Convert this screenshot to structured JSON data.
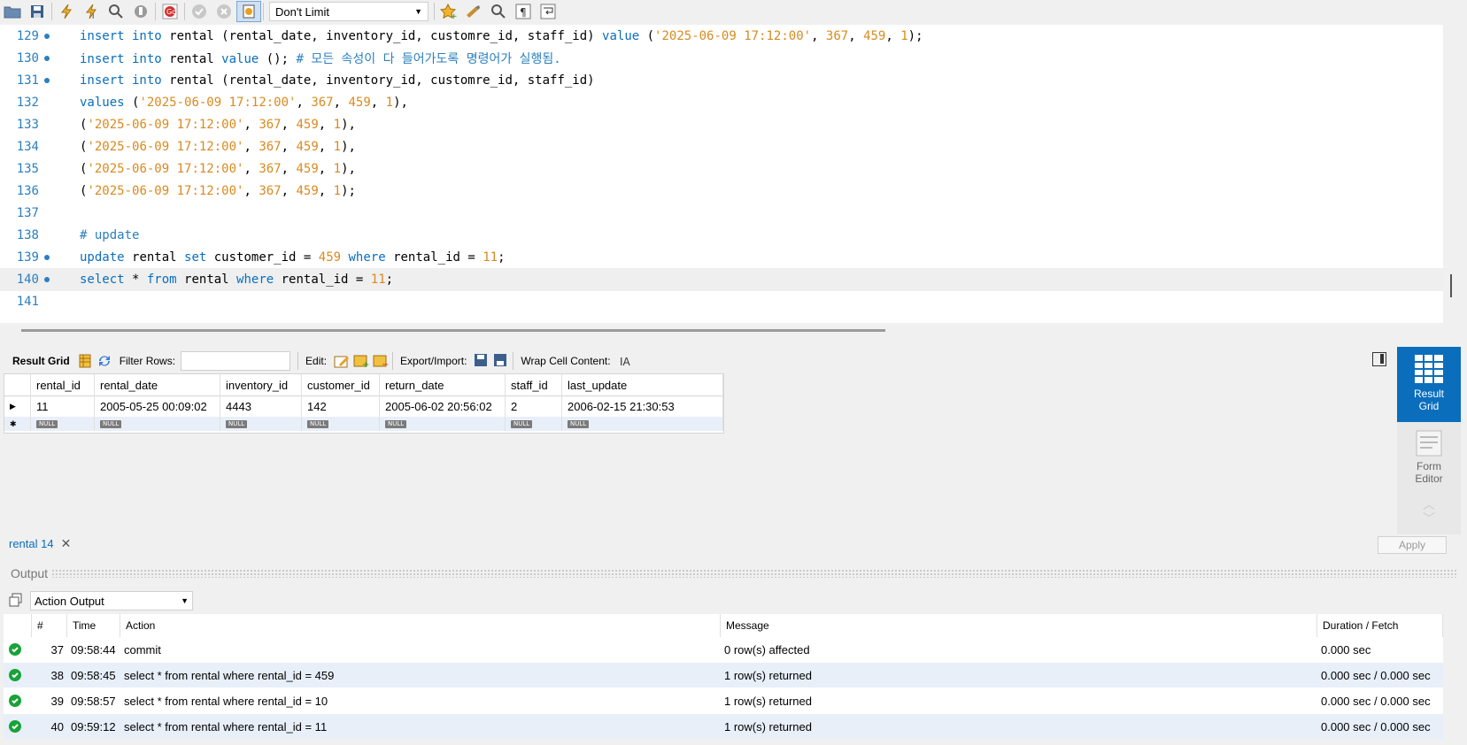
{
  "toolbar": {
    "limit": "Don't Limit",
    "icons": [
      "open-folder-icon",
      "save-icon",
      "execute-icon",
      "execute-current-icon",
      "explain-icon",
      "stop-icon",
      "toggle-error-stop-icon",
      "commit-icon",
      "rollback-icon",
      "autocommit-icon",
      "bookmark-icon",
      "beautify-icon",
      "find-icon",
      "invisible-chars-icon",
      "wrap-lines-icon"
    ]
  },
  "editor": {
    "lines": [
      {
        "n": "129",
        "dot": true,
        "tokens": [
          [
            "kw",
            "insert into "
          ],
          [
            "",
            "rental (rental_date, inventory_id, customre_id, staff_id) "
          ],
          [
            "kw",
            "value "
          ],
          [
            "",
            "("
          ],
          [
            "str",
            "'2025-06-09 17:12:00'"
          ],
          [
            "",
            ", "
          ],
          [
            "num",
            "367"
          ],
          [
            "",
            ", "
          ],
          [
            "num",
            "459"
          ],
          [
            "",
            ", "
          ],
          [
            "num",
            "1"
          ],
          [
            "",
            ");"
          ]
        ]
      },
      {
        "n": "130",
        "dot": true,
        "tokens": [
          [
            "kw",
            "insert into "
          ],
          [
            "",
            "rental "
          ],
          [
            "kw",
            "value "
          ],
          [
            "",
            "(); "
          ],
          [
            "cm",
            "# 모든 속성이 다 들어가도록 명령어가 실행됨."
          ]
        ]
      },
      {
        "n": "131",
        "dot": true,
        "tokens": [
          [
            "kw",
            "insert into "
          ],
          [
            "",
            "rental (rental_date, inventory_id, customre_id, staff_id)"
          ]
        ]
      },
      {
        "n": "132",
        "dot": false,
        "tokens": [
          [
            "kw",
            "values "
          ],
          [
            "",
            "("
          ],
          [
            "str",
            "'2025-06-09 17:12:00'"
          ],
          [
            "",
            ", "
          ],
          [
            "num",
            "367"
          ],
          [
            "",
            ", "
          ],
          [
            "num",
            "459"
          ],
          [
            "",
            ", "
          ],
          [
            "num",
            "1"
          ],
          [
            "",
            "),"
          ]
        ]
      },
      {
        "n": "133",
        "dot": false,
        "tokens": [
          [
            "",
            "("
          ],
          [
            "str",
            "'2025-06-09 17:12:00'"
          ],
          [
            "",
            ", "
          ],
          [
            "num",
            "367"
          ],
          [
            "",
            ", "
          ],
          [
            "num",
            "459"
          ],
          [
            "",
            ", "
          ],
          [
            "num",
            "1"
          ],
          [
            "",
            "),"
          ]
        ]
      },
      {
        "n": "134",
        "dot": false,
        "tokens": [
          [
            "",
            "("
          ],
          [
            "str",
            "'2025-06-09 17:12:00'"
          ],
          [
            "",
            ", "
          ],
          [
            "num",
            "367"
          ],
          [
            "",
            ", "
          ],
          [
            "num",
            "459"
          ],
          [
            "",
            ", "
          ],
          [
            "num",
            "1"
          ],
          [
            "",
            "),"
          ]
        ]
      },
      {
        "n": "135",
        "dot": false,
        "tokens": [
          [
            "",
            "("
          ],
          [
            "str",
            "'2025-06-09 17:12:00'"
          ],
          [
            "",
            ", "
          ],
          [
            "num",
            "367"
          ],
          [
            "",
            ", "
          ],
          [
            "num",
            "459"
          ],
          [
            "",
            ", "
          ],
          [
            "num",
            "1"
          ],
          [
            "",
            "),"
          ]
        ]
      },
      {
        "n": "136",
        "dot": false,
        "tokens": [
          [
            "",
            "("
          ],
          [
            "str",
            "'2025-06-09 17:12:00'"
          ],
          [
            "",
            ", "
          ],
          [
            "num",
            "367"
          ],
          [
            "",
            ", "
          ],
          [
            "num",
            "459"
          ],
          [
            "",
            ", "
          ],
          [
            "num",
            "1"
          ],
          [
            "",
            ");"
          ]
        ]
      },
      {
        "n": "137",
        "dot": false,
        "tokens": []
      },
      {
        "n": "138",
        "dot": false,
        "tokens": [
          [
            "cm",
            "# update"
          ]
        ]
      },
      {
        "n": "139",
        "dot": true,
        "tokens": [
          [
            "kw",
            "update "
          ],
          [
            "",
            "rental "
          ],
          [
            "kw",
            "set "
          ],
          [
            "",
            "customer_id = "
          ],
          [
            "num",
            "459 "
          ],
          [
            "kw",
            "where "
          ],
          [
            "",
            "rental_id = "
          ],
          [
            "num",
            "11"
          ],
          [
            "",
            ";"
          ]
        ]
      },
      {
        "n": "140",
        "dot": true,
        "active": true,
        "tokens": [
          [
            "kw",
            "select "
          ],
          [
            "",
            "* "
          ],
          [
            "kw",
            "from "
          ],
          [
            "",
            "rental "
          ],
          [
            "kw",
            "where "
          ],
          [
            "",
            "rental_id = "
          ],
          [
            "num",
            "11"
          ],
          [
            "",
            ";"
          ]
        ]
      },
      {
        "n": "141",
        "dot": false,
        "tokens": []
      }
    ]
  },
  "result_toolbar": {
    "result_grid": "Result Grid",
    "filter_rows": "Filter Rows:",
    "edit": "Edit:",
    "export_import": "Export/Import:",
    "wrap_cell": "Wrap Cell Content:"
  },
  "grid": {
    "columns": [
      "rental_id",
      "rental_date",
      "inventory_id",
      "customer_id",
      "return_date",
      "staff_id",
      "last_update"
    ],
    "rows": [
      [
        "11",
        "2005-05-25 00:09:02",
        "4443",
        "142",
        "2005-06-02 20:56:02",
        "2",
        "2006-02-15 21:30:53"
      ]
    ],
    "null_label": "NULL"
  },
  "side_panel": {
    "result_grid": [
      "Result",
      "Grid"
    ],
    "form_editor": [
      "Form",
      "Editor"
    ]
  },
  "tabs": {
    "result_tab": "rental 14",
    "apply": "Apply"
  },
  "output": {
    "title": "Output",
    "selector": "Action Output",
    "columns": [
      "#",
      "Time",
      "Action",
      "Message",
      "Duration / Fetch"
    ],
    "rows": [
      [
        "37",
        "09:58:44",
        "commit",
        "0 row(s) affected",
        "0.000 sec"
      ],
      [
        "38",
        "09:58:45",
        "select * from rental where rental_id = 459",
        "1 row(s) returned",
        "0.000 sec / 0.000 sec"
      ],
      [
        "39",
        "09:58:57",
        "select * from rental where rental_id = 10",
        "1 row(s) returned",
        "0.000 sec / 0.000 sec"
      ],
      [
        "40",
        "09:59:12",
        "select * from rental where rental_id = 11",
        "1 row(s) returned",
        "0.000 sec / 0.000 sec"
      ]
    ]
  },
  "colors": {
    "accent": "#0a6ebd",
    "string": "#d98a1f",
    "success": "#18a23a"
  }
}
